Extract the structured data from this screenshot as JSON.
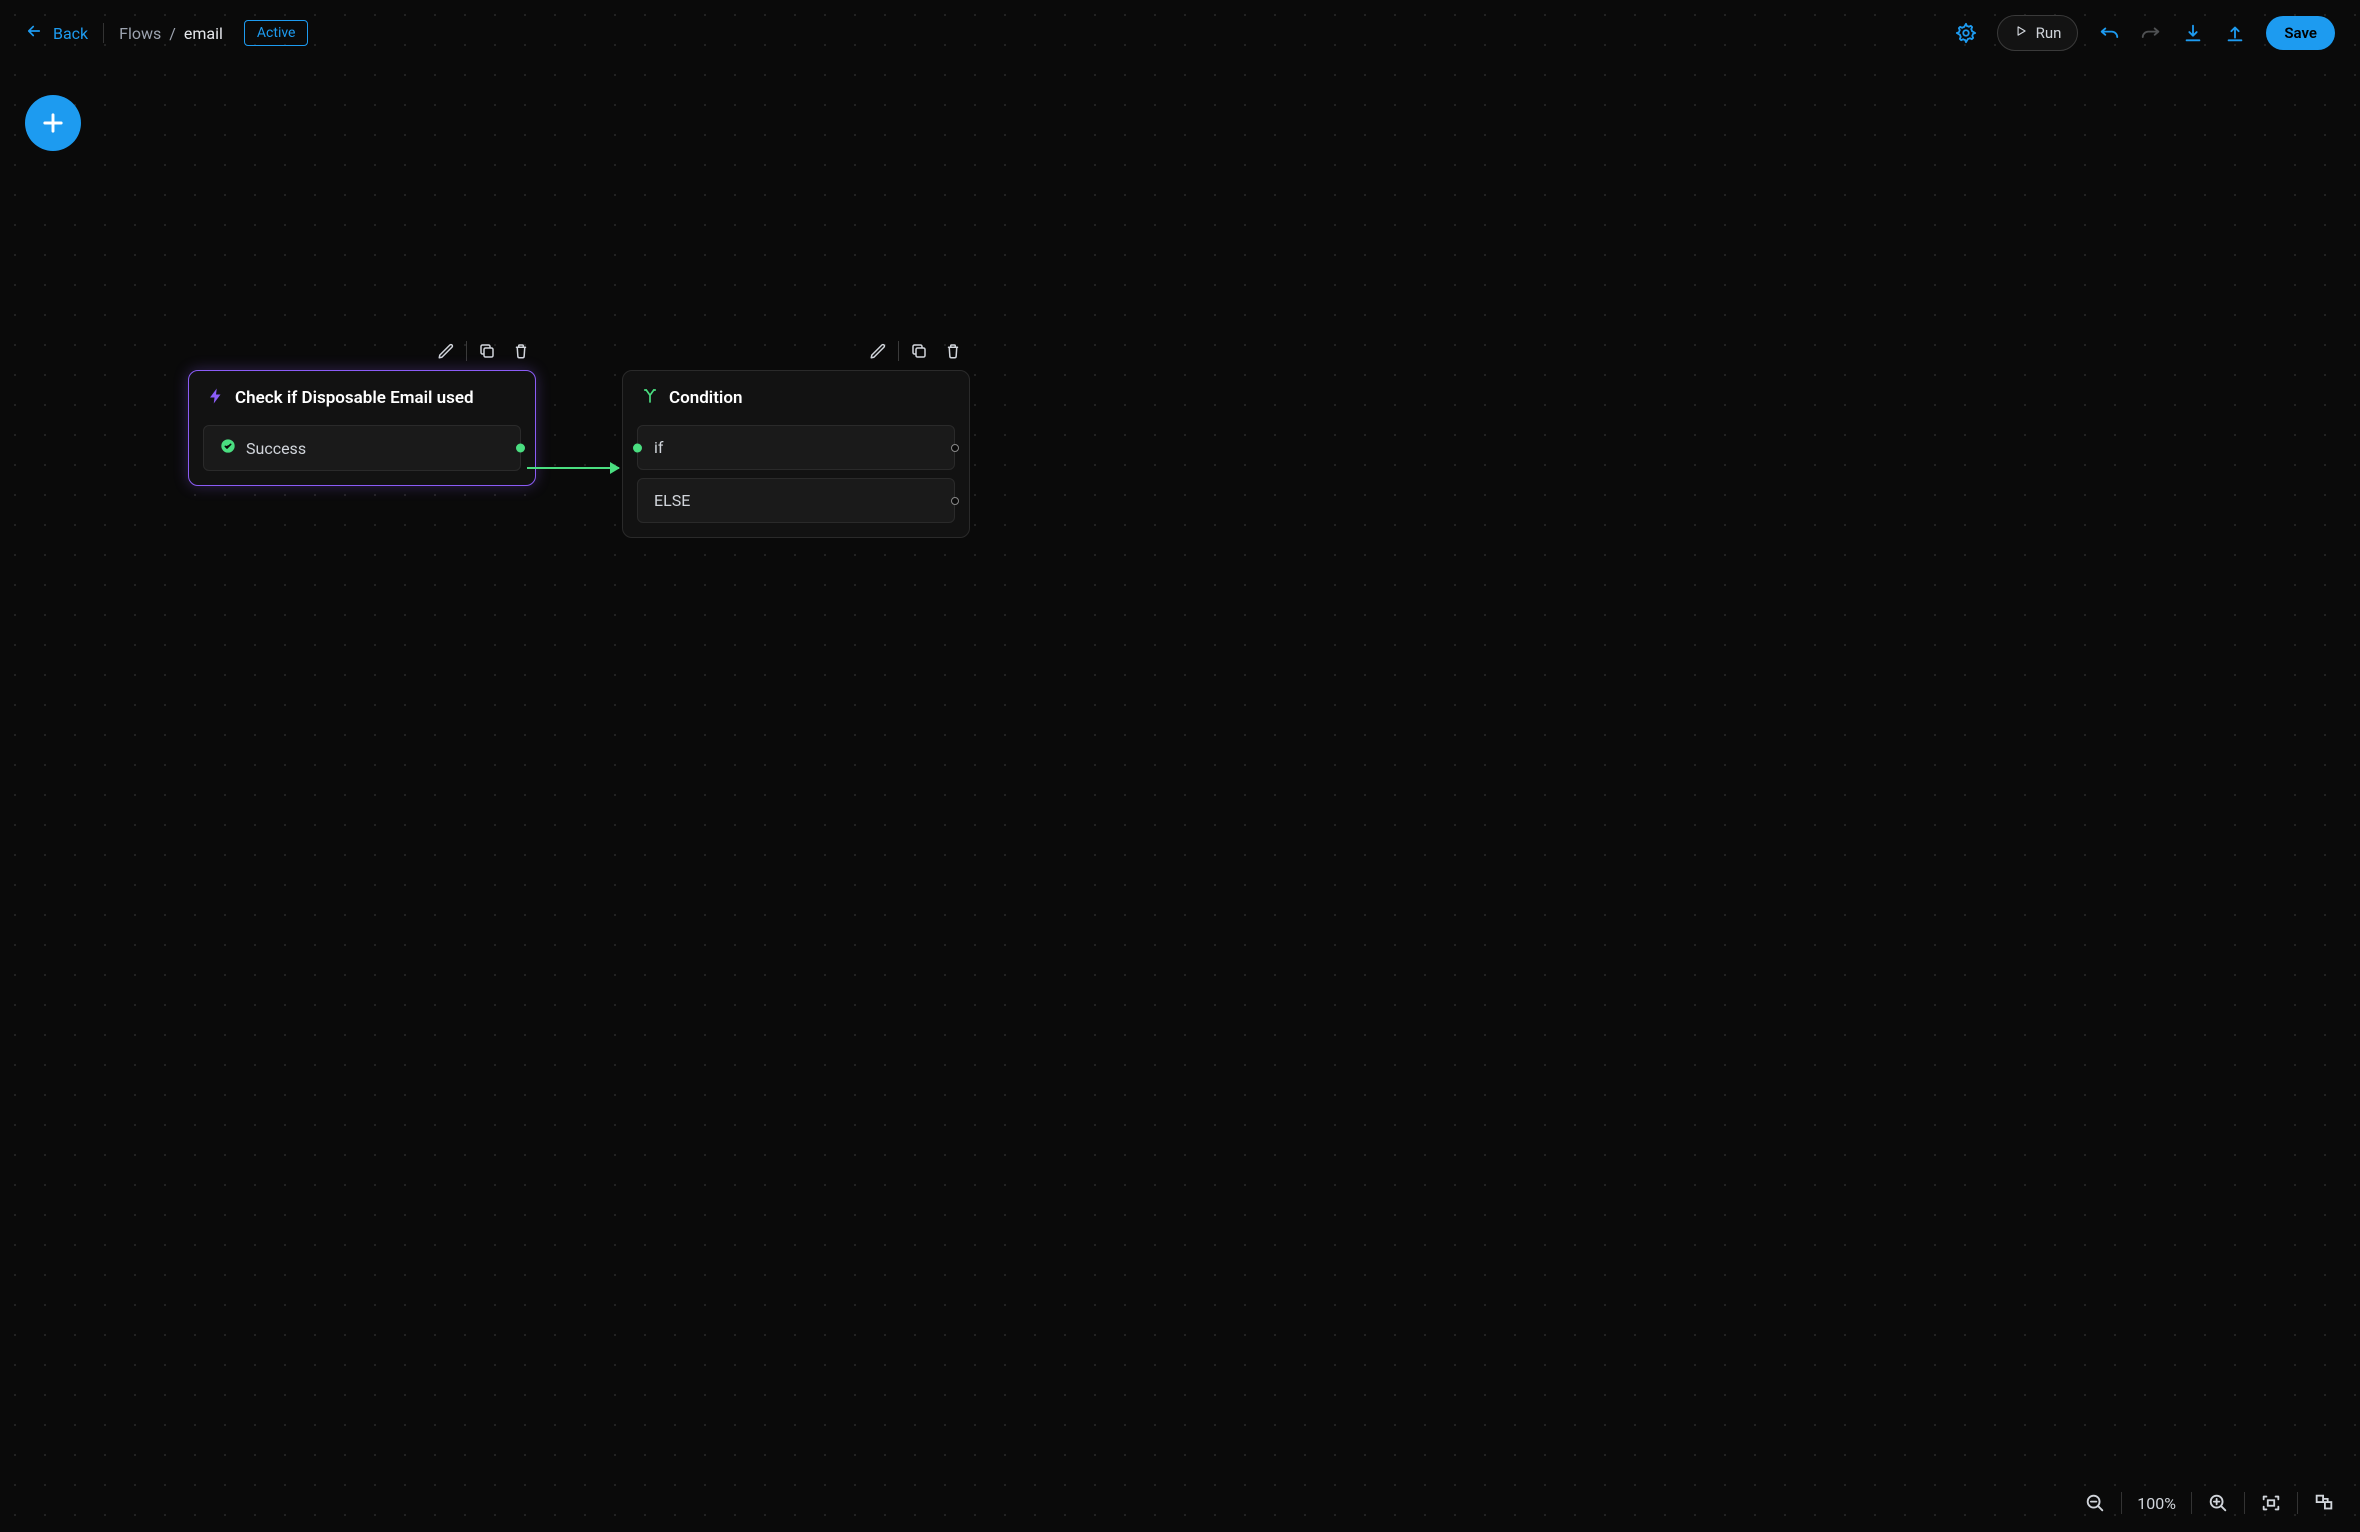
{
  "header": {
    "back_label": "Back",
    "breadcrumb_root": "Flows",
    "breadcrumb_current": "email",
    "status": "Active",
    "run_label": "Run",
    "save_label": "Save"
  },
  "canvas": {
    "zoom": "100%"
  },
  "nodes": {
    "trigger": {
      "title": "Check if Disposable Email used",
      "success_label": "Success"
    },
    "condition": {
      "title": "Condition",
      "if_label": "if",
      "else_label": "ELSE"
    }
  },
  "colors": {
    "accent": "#1d9bf0",
    "select": "#8b5cf6",
    "success": "#4ade80",
    "bg": "#0a0a0a"
  }
}
